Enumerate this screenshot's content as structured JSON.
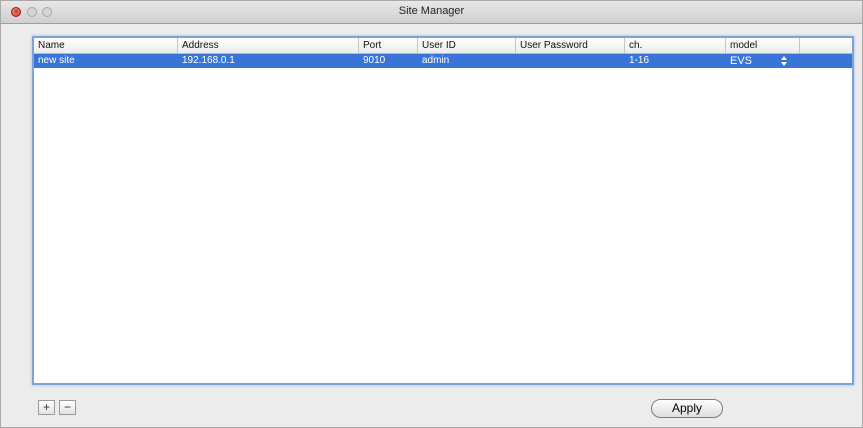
{
  "window": {
    "title": "Site Manager"
  },
  "table": {
    "columns": [
      "Name",
      "Address",
      "Port",
      "User ID",
      "User Password",
      "ch.",
      "model"
    ],
    "rows": [
      {
        "name": "new site",
        "address": "192.168.0.1",
        "port": "9010",
        "user_id": "admin",
        "user_password": "",
        "ch": "1-16",
        "model": "EVS"
      }
    ],
    "selected_row_color": "#3875d7"
  },
  "footer": {
    "add_label": "+",
    "remove_label": "−",
    "apply_label": "Apply"
  },
  "icons": {
    "close": "close-icon",
    "minimize": "minimize-icon",
    "zoom": "zoom-icon",
    "model_stepper": "updown-arrows-icon"
  }
}
